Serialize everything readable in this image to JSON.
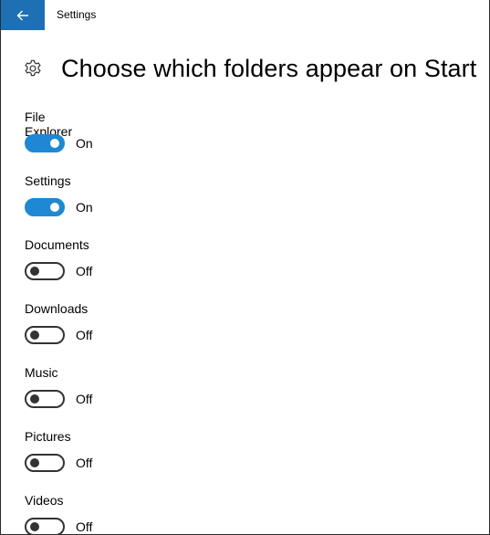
{
  "window": {
    "title": "Settings",
    "accent_color": "#1e6fb4"
  },
  "header": {
    "icon": "gear-icon",
    "title": "Choose which folders appear on Start"
  },
  "settings": [
    {
      "label": "File Explorer",
      "on": true,
      "state_text": "On"
    },
    {
      "label": "Settings",
      "on": true,
      "state_text": "On"
    },
    {
      "label": "Documents",
      "on": false,
      "state_text": "Off"
    },
    {
      "label": "Downloads",
      "on": false,
      "state_text": "Off"
    },
    {
      "label": "Music",
      "on": false,
      "state_text": "Off"
    },
    {
      "label": "Pictures",
      "on": false,
      "state_text": "Off"
    },
    {
      "label": "Videos",
      "on": false,
      "state_text": "Off"
    }
  ],
  "colors": {
    "toggle_on": "#1e88d4",
    "toggle_off_border": "#333333"
  }
}
